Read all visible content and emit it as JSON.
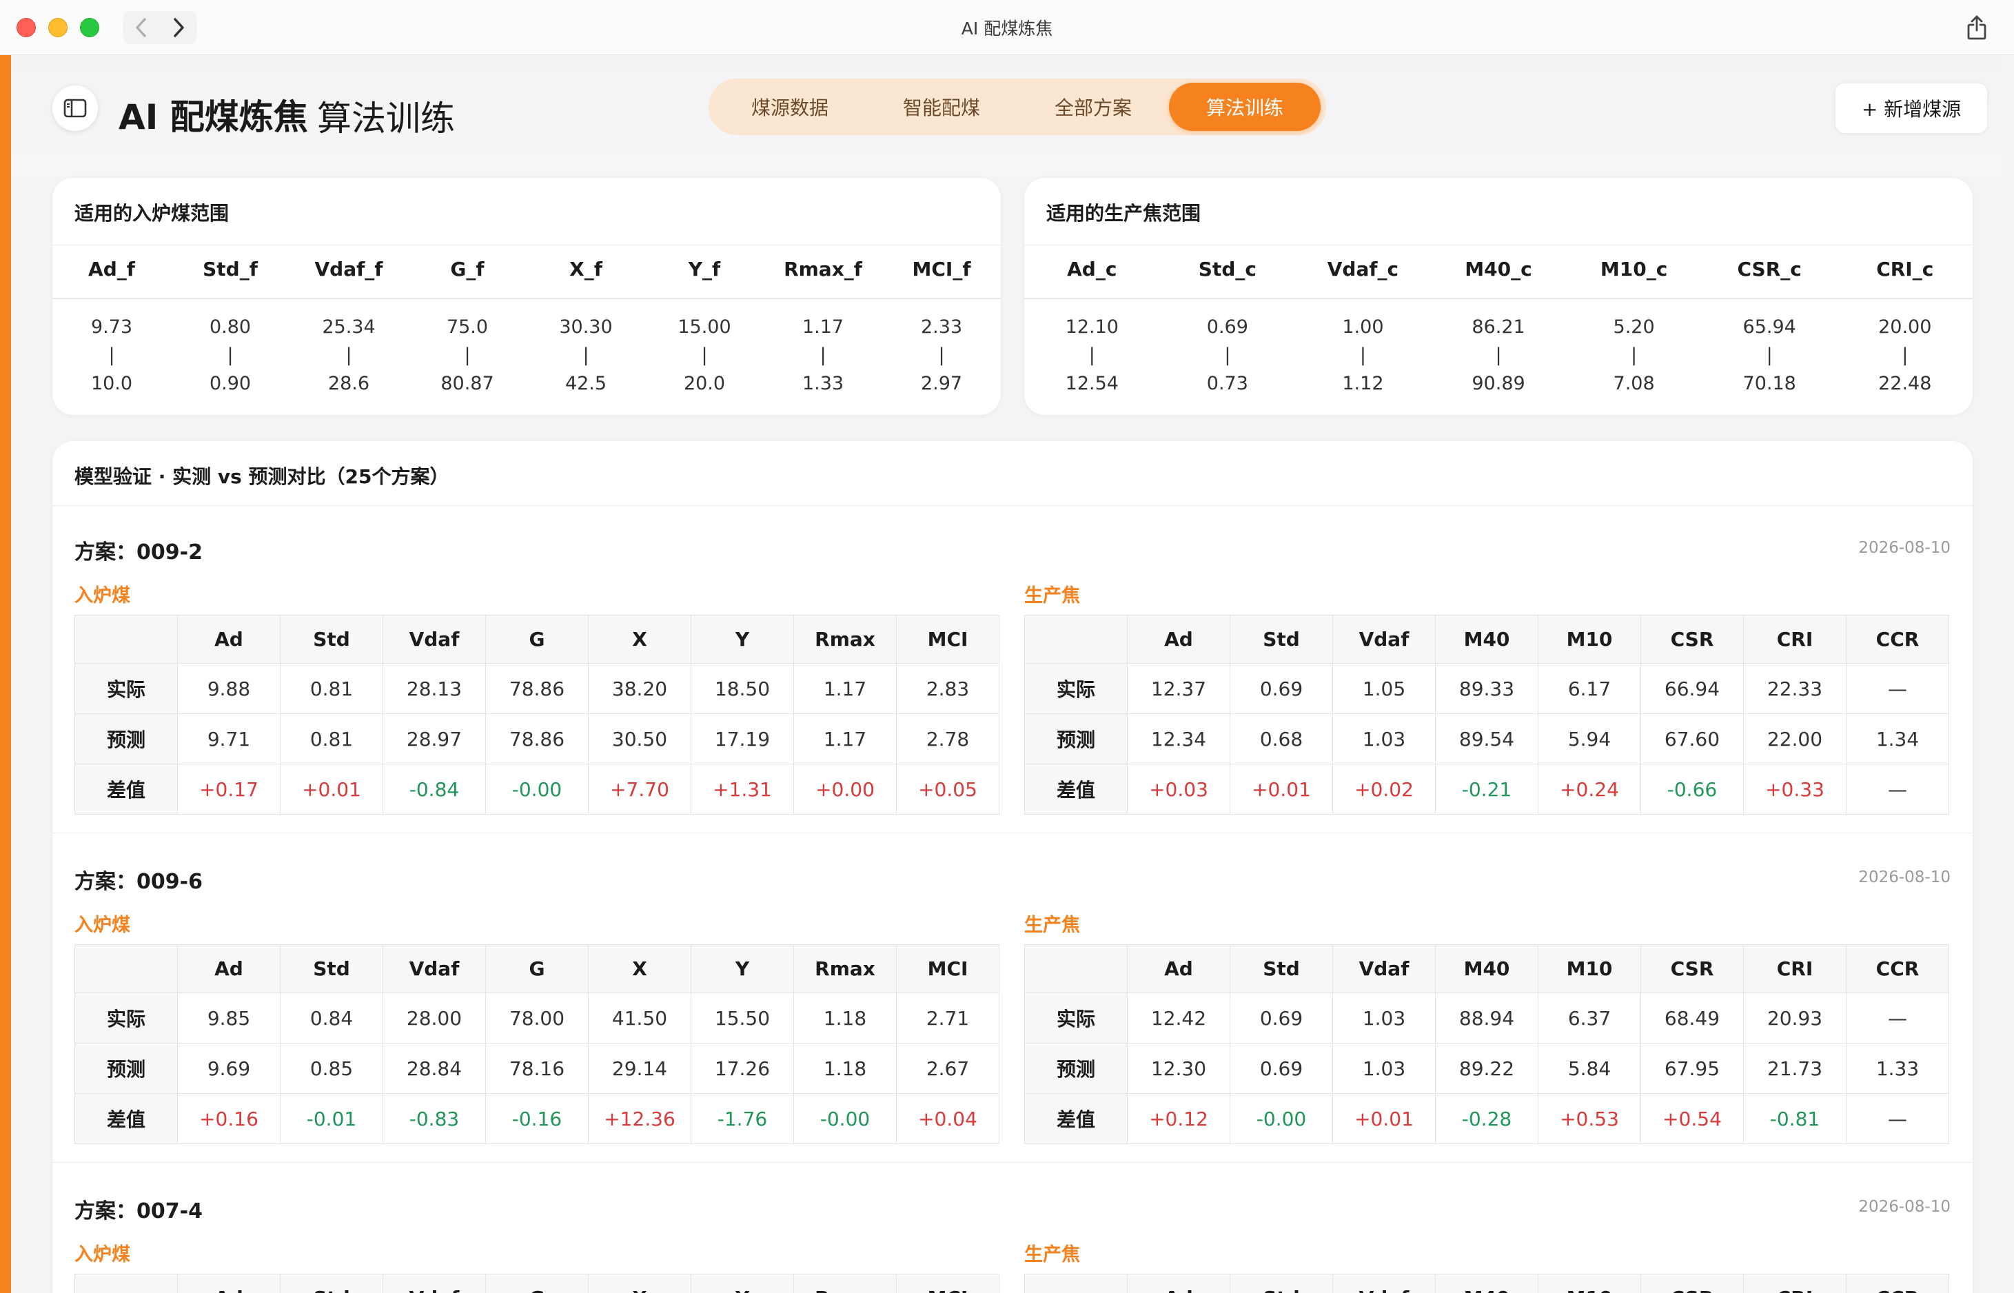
{
  "window": {
    "title": "AI 配煤炼焦"
  },
  "header": {
    "title": "AI 配煤炼焦",
    "subtitle": "算法训练",
    "tabs": [
      {
        "label": "煤源数据",
        "active": false
      },
      {
        "label": "智能配煤",
        "active": false
      },
      {
        "label": "全部方案",
        "active": false
      },
      {
        "label": "算法训练",
        "active": true
      }
    ],
    "add_button": "+ 新增煤源"
  },
  "colors": {
    "accent": "#f5821f",
    "positive": "#d93a3a",
    "negative": "#22965a"
  },
  "coal_range": {
    "title": "适用的入炉煤范围",
    "columns": [
      "Ad_f",
      "Std_f",
      "Vdaf_f",
      "G_f",
      "X_f",
      "Y_f",
      "Rmax_f",
      "MCI_f"
    ],
    "min": [
      "9.73",
      "0.80",
      "25.34",
      "75.0",
      "30.30",
      "15.00",
      "1.17",
      "2.33"
    ],
    "max": [
      "10.0",
      "0.90",
      "28.6",
      "80.87",
      "42.5",
      "20.0",
      "1.33",
      "2.97"
    ],
    "separator": "|"
  },
  "coke_range": {
    "title": "适用的生产焦范围",
    "columns": [
      "Ad_c",
      "Std_c",
      "Vdaf_c",
      "M40_c",
      "M10_c",
      "CSR_c",
      "CRI_c"
    ],
    "min": [
      "12.10",
      "0.69",
      "1.00",
      "86.21",
      "5.20",
      "65.94",
      "20.00"
    ],
    "max": [
      "12.54",
      "0.73",
      "1.12",
      "90.89",
      "7.08",
      "70.18",
      "22.48"
    ],
    "separator": "|"
  },
  "validation": {
    "title": "模型验证 · 实测 vs 预测对比（25个方案）",
    "coal_label": "入炉煤",
    "coke_label": "生产焦",
    "coal_columns": [
      "Ad",
      "Std",
      "Vdaf",
      "G",
      "X",
      "Y",
      "Rmax",
      "MCI"
    ],
    "coke_columns": [
      "Ad",
      "Std",
      "Vdaf",
      "M40",
      "M10",
      "CSR",
      "CRI",
      "CCR"
    ],
    "row_labels": [
      "实际",
      "预测",
      "差值"
    ],
    "schemes": [
      {
        "name": "方案：009-2",
        "date": "2026-08-10",
        "coal": {
          "actual": [
            "9.88",
            "0.81",
            "28.13",
            "78.86",
            "38.20",
            "18.50",
            "1.17",
            "2.83"
          ],
          "predicted": [
            "9.71",
            "0.81",
            "28.97",
            "78.86",
            "30.50",
            "17.19",
            "1.17",
            "2.78"
          ],
          "diff": [
            "+0.17",
            "+0.01",
            "-0.84",
            "-0.00",
            "+7.70",
            "+1.31",
            "+0.00",
            "+0.05"
          ]
        },
        "coke": {
          "actual": [
            "12.37",
            "0.69",
            "1.05",
            "89.33",
            "6.17",
            "66.94",
            "22.33",
            "—"
          ],
          "predicted": [
            "12.34",
            "0.68",
            "1.03",
            "89.54",
            "5.94",
            "67.60",
            "22.00",
            "1.34"
          ],
          "diff": [
            "+0.03",
            "+0.01",
            "+0.02",
            "-0.21",
            "+0.24",
            "-0.66",
            "+0.33",
            "—"
          ]
        }
      },
      {
        "name": "方案：009-6",
        "date": "2026-08-10",
        "coal": {
          "actual": [
            "9.85",
            "0.84",
            "28.00",
            "78.00",
            "41.50",
            "15.50",
            "1.18",
            "2.71"
          ],
          "predicted": [
            "9.69",
            "0.85",
            "28.84",
            "78.16",
            "29.14",
            "17.26",
            "1.18",
            "2.67"
          ],
          "diff": [
            "+0.16",
            "-0.01",
            "-0.83",
            "-0.16",
            "+12.36",
            "-1.76",
            "-0.00",
            "+0.04"
          ]
        },
        "coke": {
          "actual": [
            "12.42",
            "0.69",
            "1.03",
            "88.94",
            "6.37",
            "68.49",
            "20.93",
            "—"
          ],
          "predicted": [
            "12.30",
            "0.69",
            "1.03",
            "89.22",
            "5.84",
            "67.95",
            "21.73",
            "1.33"
          ],
          "diff": [
            "+0.12",
            "-0.00",
            "+0.01",
            "-0.28",
            "+0.53",
            "+0.54",
            "-0.81",
            "—"
          ]
        }
      },
      {
        "name": "方案：007-4",
        "date": "2026-08-10"
      }
    ]
  }
}
